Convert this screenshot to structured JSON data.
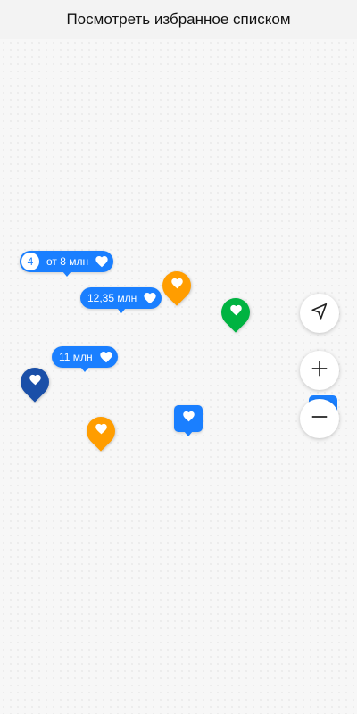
{
  "header": {
    "title": "Посмотреть избранное списком"
  },
  "colors": {
    "tag_blue": "#1a7fff",
    "orange": "#ff9d00",
    "green": "#00b341",
    "navy": "#1a4fa8"
  },
  "map": {
    "price_tags": [
      {
        "count": "4",
        "label": "от 8 млн",
        "icon": "heart-icon"
      },
      {
        "label": "12,35 млн",
        "icon": "heart-icon"
      },
      {
        "label": "11 млн",
        "icon": "heart-icon"
      }
    ],
    "pins": [
      {
        "color": "orange",
        "icon": "heart-icon"
      },
      {
        "color": "green",
        "icon": "heart-icon"
      },
      {
        "color": "navy",
        "icon": "heart-icon"
      },
      {
        "color": "orange",
        "icon": "heart-icon"
      },
      {
        "color": "blue",
        "icon": "heart-icon"
      }
    ]
  },
  "controls": {
    "locate_icon": "navigation-arrow-icon",
    "zoom_in_icon": "plus-icon",
    "zoom_out_icon": "minus-icon"
  }
}
